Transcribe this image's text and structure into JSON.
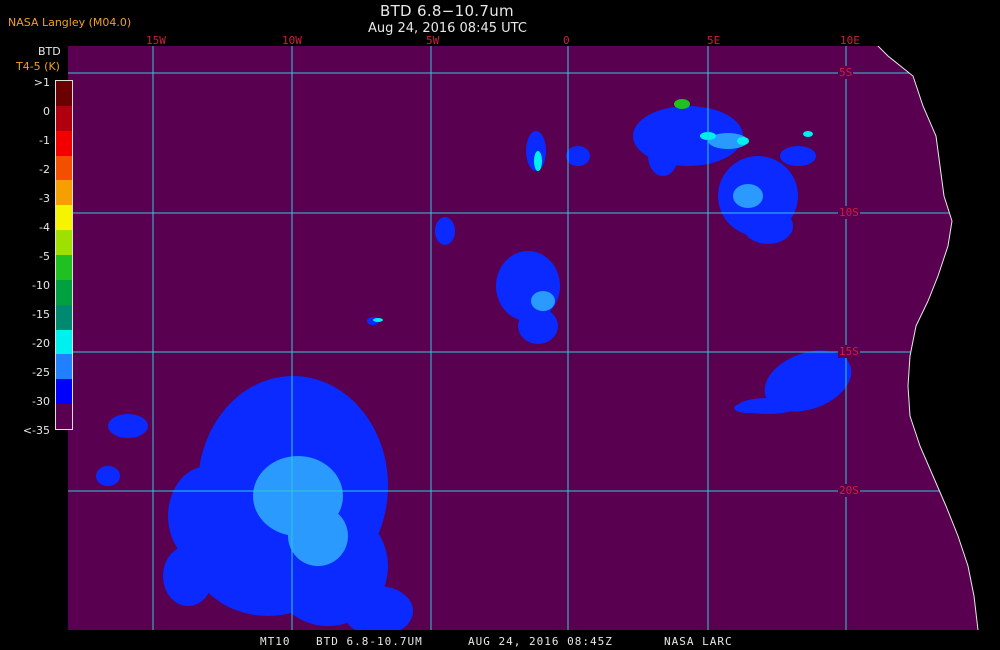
{
  "header": {
    "source": "NASA Langley (M04.0)",
    "title": "BTD 6.8−10.7um",
    "subtitle": "Aug 24, 2016 08:45 UTC"
  },
  "legend": {
    "title": "BTD",
    "unit": "T4-5 (K)",
    "ticks": [
      ">1",
      "0",
      "-1",
      "-2",
      "-3",
      "-4",
      "-5",
      "-10",
      "-15",
      "-20",
      "-25",
      "-30",
      "<-35"
    ],
    "colors": [
      "#6a0000",
      "#b00010",
      "#f20000",
      "#f25000",
      "#f5a000",
      "#f5f500",
      "#a0e000",
      "#20c020",
      "#00a040",
      "#008870",
      "#00f0f0",
      "#2080ff",
      "#0000ff",
      "#5a0050"
    ]
  },
  "map": {
    "background_color": "#5a0050",
    "grid_color": "#30c8d8",
    "coast_color": "#e8e8e8",
    "longitude_labels": [
      "15W",
      "10W",
      "5W",
      "0",
      "5E",
      "10E"
    ],
    "latitude_labels": [
      "5S",
      "10S",
      "15S",
      "20S"
    ]
  },
  "footer": {
    "satellite": "MT10",
    "product": "BTD 6.8-10.7UM",
    "datetime": "AUG 24, 2016 08:45Z",
    "agency": "NASA LARC"
  }
}
